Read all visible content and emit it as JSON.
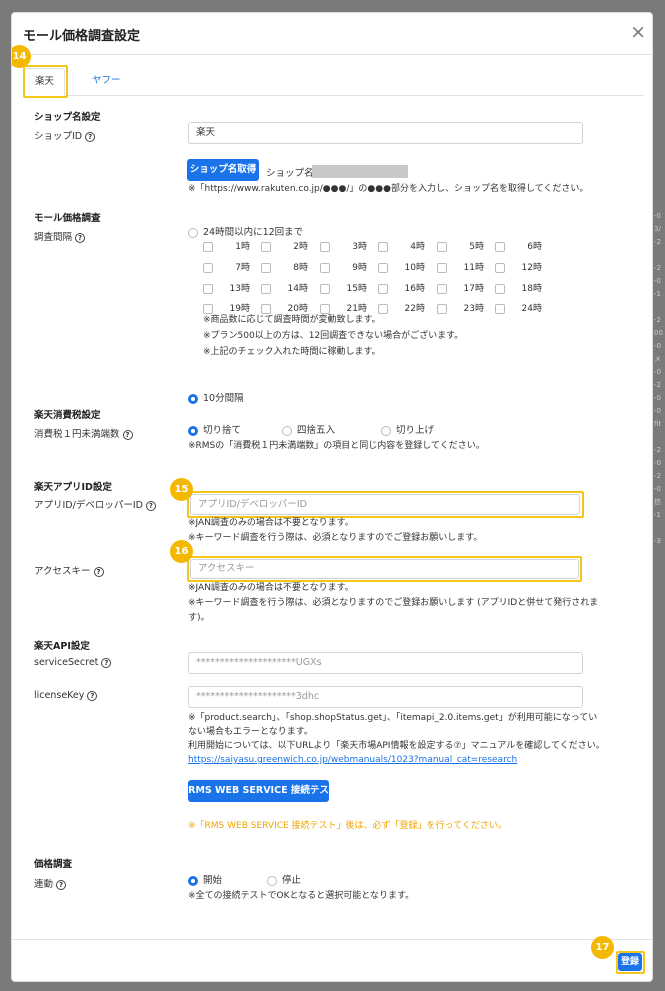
{
  "background_strip": [
    "-0",
    "3/",
    "-2",
    "",
    "-2",
    "-0",
    "-1",
    "",
    "-2",
    "00",
    "-0",
    "メ",
    "-0",
    "-2",
    "-0",
    "-0",
    "fit",
    "",
    "-2",
    "-0",
    "-2",
    "-0",
    "信",
    "-1",
    "",
    "-3"
  ],
  "modal": {
    "title": "モール価格調査設定",
    "close_label": "×",
    "tabs": [
      {
        "label": "楽天"
      },
      {
        "label": "ヤフー"
      }
    ],
    "badges": {
      "b14": "14",
      "b15": "15",
      "b16": "16",
      "b17": "17"
    }
  },
  "shop": {
    "section": "ショップ名設定",
    "id_label": "ショップID",
    "id_value": "楽天",
    "fetch_button": "ショップ名取得",
    "name_label": "ショップ名：",
    "note": "※「https://www.rakuten.co.jp/●●●/」の●●●部分を入力し、ショップ名を取得してください。"
  },
  "survey": {
    "section": "モール価格調査",
    "interval_label": "調査間隔",
    "option_24h": "24時間以内に12回まで",
    "hours": [
      "1時",
      "2時",
      "3時",
      "4時",
      "5時",
      "6時",
      "7時",
      "8時",
      "9時",
      "10時",
      "11時",
      "12時",
      "13時",
      "14時",
      "15時",
      "16時",
      "17時",
      "18時",
      "19時",
      "20時",
      "21時",
      "22時",
      "23時",
      "24時"
    ],
    "notes": [
      "※商品数に応じて調査時間が変動致します。",
      "※プラン500以上の方は、12回調査できない場合がございます。",
      "※上記のチェック入れた時間に稼動します。"
    ],
    "option_10min": "10分間隔"
  },
  "tax": {
    "section": "楽天消費税設定",
    "label": "消費税１円未満端数",
    "options": [
      "切り捨て",
      "四捨五入",
      "切り上げ"
    ],
    "note": "※RMSの「消費税１円未満端数」の項目と同じ内容を登録してください。"
  },
  "app": {
    "section": "楽天アプリID設定",
    "id_label": "アプリID/デベロッパーID",
    "id_placeholder": "アプリID/デベロッパーID",
    "id_notes": [
      "※JAN調査のみの場合は不要となります。",
      "※キーワード調査を行う際は、必須となりますのでご登録お願いします。"
    ],
    "key_label": "アクセスキー",
    "key_placeholder": "アクセスキー",
    "key_notes": [
      "※JAN調査のみの場合は不要となります。",
      "※キーワード調査を行う際は、必須となりますのでご登録お願いします (アプリIDと併せて発行されま",
      "す)。"
    ]
  },
  "api": {
    "section": "楽天API設定",
    "secret_label": "serviceSecret",
    "secret_value": "*********************UGXs",
    "license_label": "licenseKey",
    "license_value": "*********************3dhc",
    "notes": [
      "※「product.search」、「shop.shopStatus.get」、「itemapi_2.0.items.get」が利用可能になってい",
      "ない場合もエラーとなります。",
      "利用開始については、以下URLより「楽天市場API情報を設定する⑦」マニュアルを確認してください。"
    ],
    "link": "https://saiyasu.greenwich.co.jp/webmanuals/1023?manual_cat=research",
    "test_button": "RMS WEB SERVICE 接続テスト",
    "test_note": "※「RMS WEB SERVICE 接続テスト」後は、必ず「登録」を行ってください。"
  },
  "price": {
    "section": "価格調査",
    "link_label": "連動",
    "options": [
      "開始",
      "停止"
    ],
    "note": "※全ての接続テストでOKとなると選択可能となります。"
  },
  "footer": {
    "register_button": "登録"
  }
}
